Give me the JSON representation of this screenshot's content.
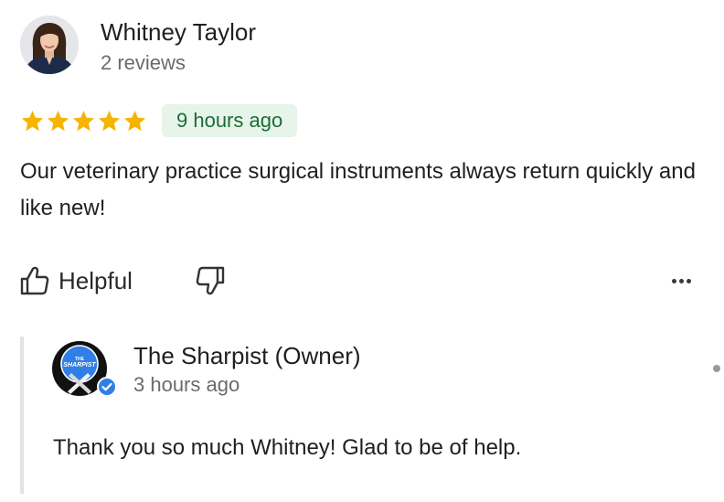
{
  "review": {
    "author_name": "Whitney Taylor",
    "author_reviews": "2 reviews",
    "rating": 5,
    "rating_max": 5,
    "star_color": "#f4b400",
    "time_ago": "9 hours ago",
    "text": "Our veterinary practice surgical instruments always return quickly and like new!"
  },
  "actions": {
    "helpful_label": "Helpful",
    "helpful_icon": "thumbs-up-icon",
    "unhelpful_icon": "thumbs-down-icon",
    "more_icon": "more-horizontal-icon"
  },
  "owner_reply": {
    "name": "The Sharpist (Owner)",
    "time_ago": "3 hours ago",
    "text": "Thank you so much Whitney! Glad to be of help.",
    "logo_text": "THE SHARPIST",
    "verified_icon": "verified-badge-icon",
    "brand_color": "#2f7fe6"
  }
}
